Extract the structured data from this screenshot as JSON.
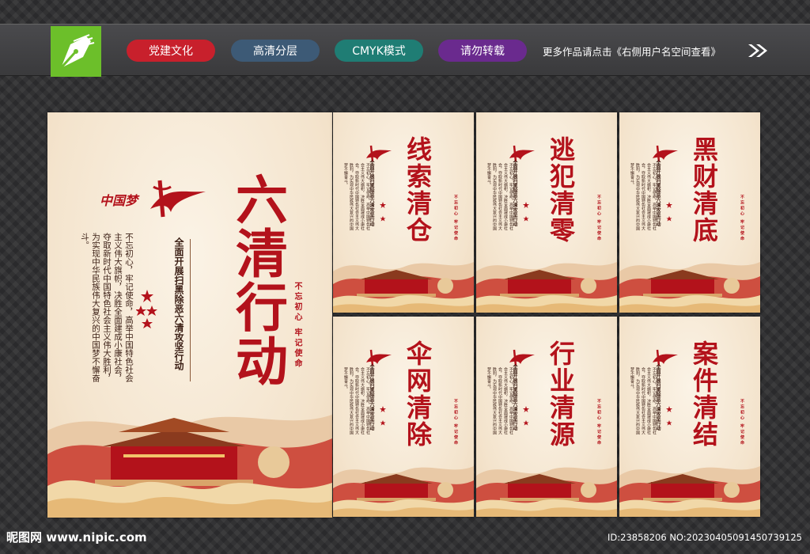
{
  "header": {
    "tags": [
      "党建文化",
      "高清分层",
      "CMYK模式",
      "请勿转载"
    ],
    "more_text": "更多作品请点击《右侧用户名空间查看》"
  },
  "main_poster": {
    "title": "六清行动",
    "subtitle": "全面开展扫黑除恶六清攻坚行动",
    "body": "不忘初心，牢记使命，高举中国特色社会主义伟大旗帜，决胜全面建成小康社会，夺取新时代中国特色社会主义伟大胜利，为实现中华民族伟大复兴的中国梦不懈奋斗。",
    "seal_text": "不忘初心 牢记使命",
    "mark_text": "中国梦"
  },
  "panels": [
    {
      "title": "线索清仓"
    },
    {
      "title": "逃犯清零"
    },
    {
      "title": "黑财清底"
    },
    {
      "title": "伞网清除"
    },
    {
      "title": "行业清源"
    },
    {
      "title": "案件清结"
    }
  ],
  "footer": {
    "left": "昵图网 www.nipic.com",
    "right": "ID:23858206 NO:20230405091450739125"
  },
  "colors": {
    "primary_red": "#b3121b",
    "paper": "#f4e4cd",
    "logo_green": "#6cbf2a"
  }
}
